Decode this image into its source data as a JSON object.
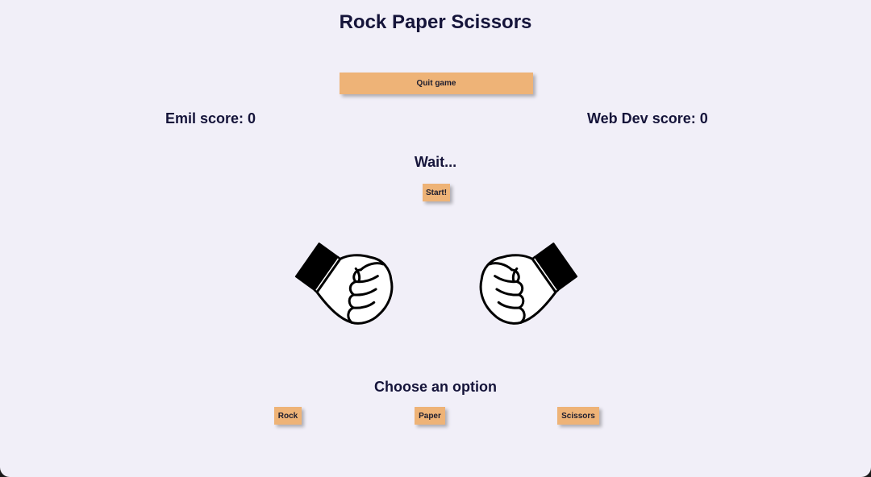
{
  "game": {
    "title": "Rock Paper Scissors",
    "quit_label": "Quit game",
    "player_score_text": "Emil score: 0",
    "opponent_score_text": "Web Dev score: 0",
    "status_text": "Wait...",
    "start_label": "Start!",
    "choose_prompt": "Choose an option",
    "options": [
      "Rock",
      "Paper",
      "Scissors"
    ]
  },
  "hands": {
    "left": "fist-icon",
    "right": "fist-icon"
  },
  "colors": {
    "background": "#f1eff8",
    "button": "#eeb377",
    "text": "#15143a"
  }
}
